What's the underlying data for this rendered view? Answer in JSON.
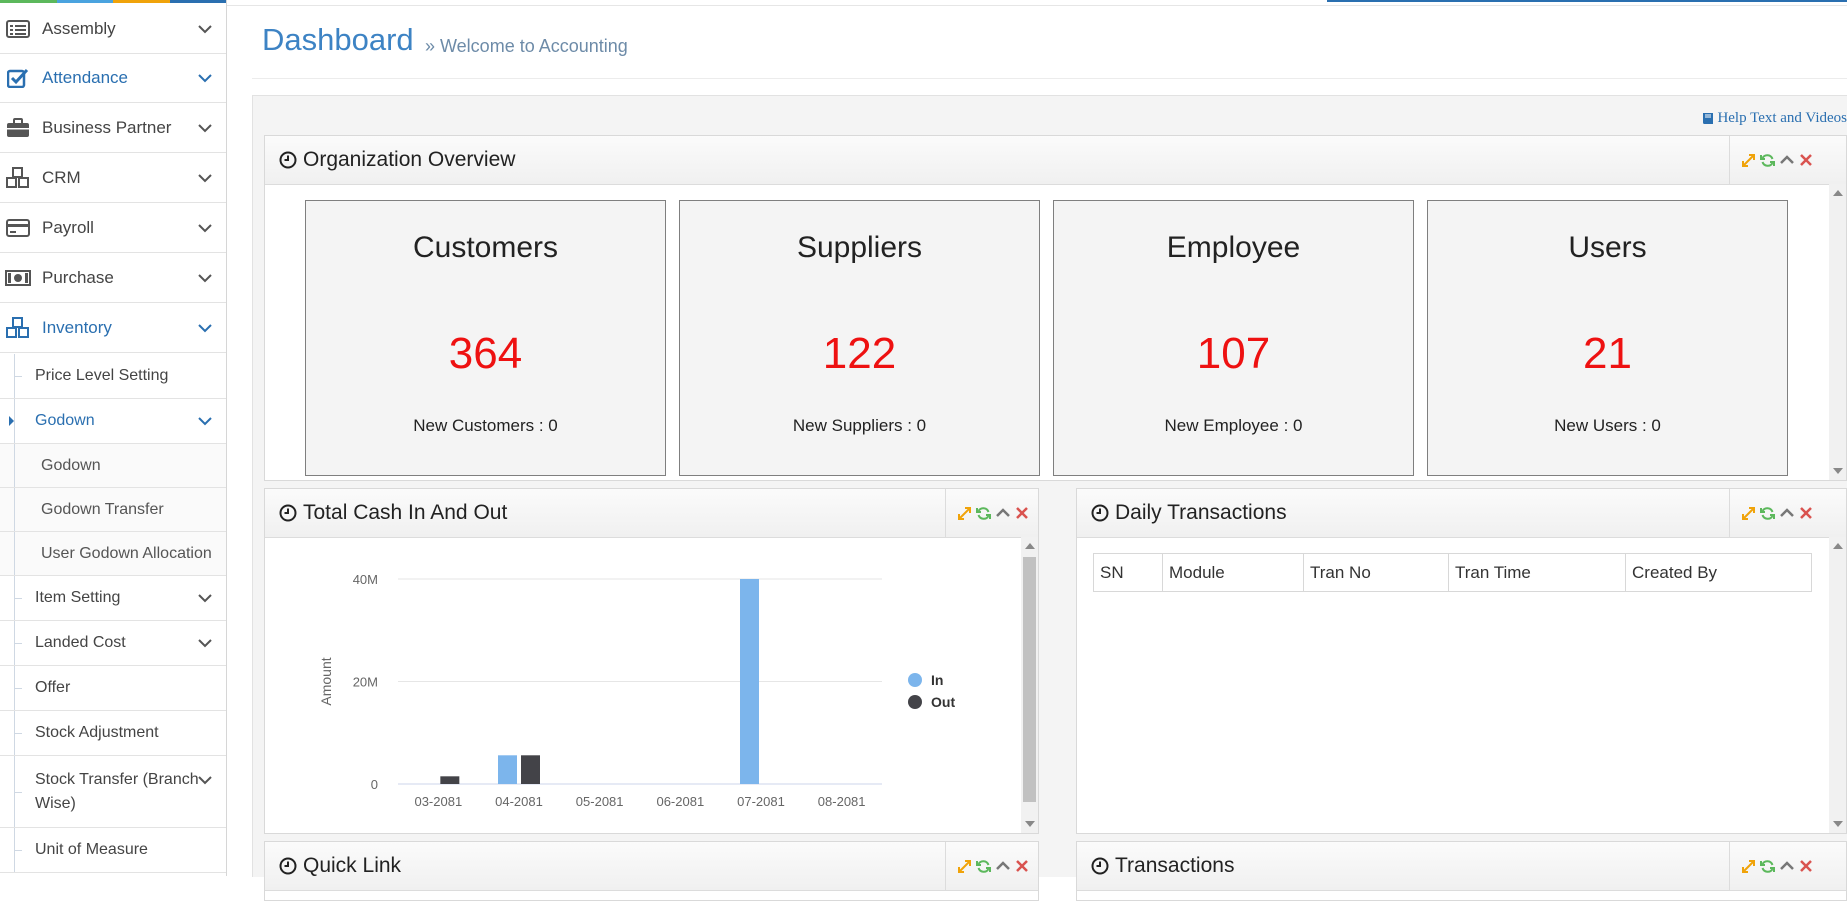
{
  "colors": {
    "accent": "#2a6fb0",
    "stat_value": "#ee1111",
    "bar_in": "#7cb5ec",
    "bar_out": "#434348",
    "tool_expand": "#f0a30a",
    "tool_refresh": "#5cb85c",
    "tool_close": "#d9534f"
  },
  "sidebar": {
    "items": [
      {
        "label": "Assembly",
        "icon": "list-icon"
      },
      {
        "label": "Attendance",
        "icon": "checkbox-icon"
      },
      {
        "label": "Business Partner",
        "icon": "briefcase-icon"
      },
      {
        "label": "CRM",
        "icon": "cubes-icon"
      },
      {
        "label": "Payroll",
        "icon": "credit-card-icon"
      },
      {
        "label": "Purchase",
        "icon": "money-icon"
      },
      {
        "label": "Inventory",
        "icon": "cubes-icon"
      }
    ],
    "inventory_children": {
      "price_level": "Price Level Setting",
      "godown": "Godown",
      "godown_children": [
        "Godown",
        "Godown Transfer",
        "User Godown Allocation"
      ],
      "item_setting": "Item Setting",
      "landed_cost": "Landed Cost",
      "offer": "Offer",
      "stock_adjustment": "Stock Adjustment",
      "stock_transfer": "Stock Transfer (Branch Wise)",
      "unit_of_measure": "Unit of Measure"
    }
  },
  "header": {
    "title": "Dashboard",
    "subtitle": "» Welcome to Accounting",
    "help": "Help Text and Videos"
  },
  "org_overview": {
    "title": "Organization Overview",
    "cards": [
      {
        "title": "Customers",
        "value": "364",
        "new": "New Customers : 0"
      },
      {
        "title": "Suppliers",
        "value": "122",
        "new": "New Suppliers : 0"
      },
      {
        "title": "Employee",
        "value": "107",
        "new": "New Employee : 0"
      },
      {
        "title": "Users",
        "value": "21",
        "new": "New Users : 0"
      }
    ]
  },
  "cash_widget": {
    "title": "Total Cash In And Out"
  },
  "daily_widget": {
    "title": "Daily Transactions",
    "columns": [
      "SN",
      "Module",
      "Tran No",
      "Tran Time",
      "Created By"
    ]
  },
  "quick_link": {
    "title": "Quick Link"
  },
  "transactions": {
    "title": "Transactions"
  },
  "chart_data": {
    "type": "bar",
    "title": "",
    "xlabel": "",
    "ylabel": "Amount",
    "categories": [
      "03-2081",
      "04-2081",
      "05-2081",
      "06-2081",
      "07-2081",
      "08-2081"
    ],
    "series": [
      {
        "name": "In",
        "values": [
          0,
          5600000,
          0,
          0,
          40000000,
          0
        ]
      },
      {
        "name": "Out",
        "values": [
          1500000,
          5600000,
          0,
          0,
          0,
          0
        ]
      }
    ],
    "ylim": [
      0,
      40000000
    ],
    "yticks": [
      "0",
      "20M",
      "40M"
    ],
    "grid": true,
    "legend": "right"
  }
}
